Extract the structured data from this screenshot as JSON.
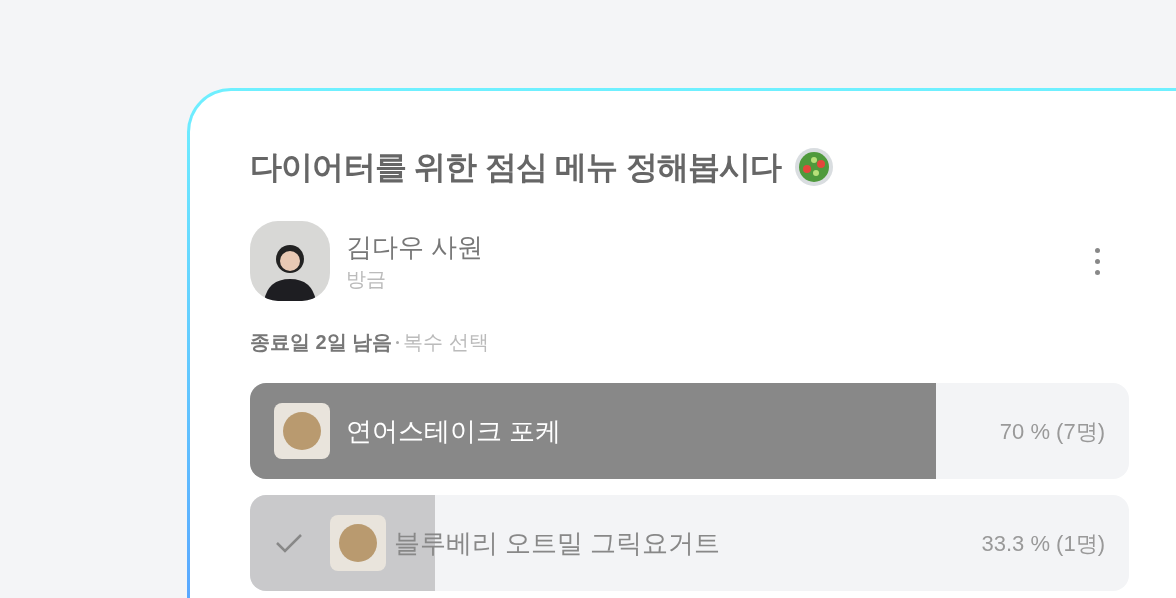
{
  "poll": {
    "title": "다이어터를 위한 점심 메뉴 정해봅시다",
    "author": {
      "name": "김다우 사원",
      "time": "방금"
    },
    "deadline": "종료일 2일 남음",
    "mode": "복수 선택",
    "options": [
      {
        "label": "연어스테이크 포케",
        "result": "70 % (7명)",
        "level": 0.78,
        "leading": true,
        "voted": false
      },
      {
        "label": "블루베리 오트밀 그릭요거트",
        "result": "33.3 % (1명)",
        "level": 0.21,
        "leading": false,
        "voted": true
      }
    ]
  }
}
